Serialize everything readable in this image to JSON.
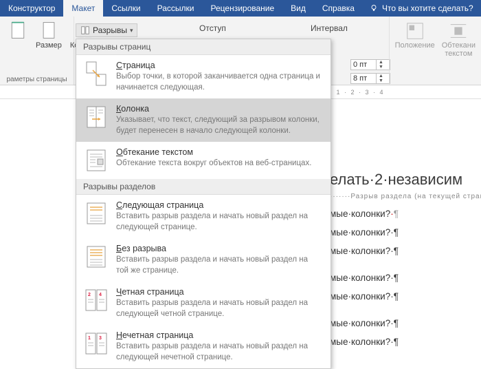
{
  "tabs": {
    "constructor": "Конструктор",
    "layout": "Макет",
    "links": "Ссылки",
    "mailings": "Рассылки",
    "review": "Рецензирование",
    "view": "Вид",
    "help": "Справка",
    "tell_me": "Что вы хотите сделать?"
  },
  "ribbon": {
    "size": "Размер",
    "columns": "Колонки",
    "page_setup": "раметры страницы",
    "breaks_btn": "Разрывы",
    "indent": "Отступ",
    "interval": "Интервал",
    "before_val": "0 пт",
    "after_val": "8 пт",
    "position": "Положение",
    "wrap": "Обтекани",
    "wrap2": "текстом"
  },
  "dropdown": {
    "section1": "Разрывы страниц",
    "items1": [
      {
        "title": "Страница",
        "ul": "С",
        "desc": "Выбор точки, в которой заканчивается одна страница и начинается следующая."
      },
      {
        "title": "Колонка",
        "ul": "К",
        "desc": "Указывает, что текст, следующий за разрывом колонки, будет перенесен в начало следующей колонки."
      },
      {
        "title": "Обтекание текстом",
        "ul": "О",
        "desc": "Обтекание текста вокруг объектов на веб-страницах."
      }
    ],
    "section2": "Разрывы разделов",
    "items2": [
      {
        "title": "Следующая страница",
        "ul": "С",
        "desc": "Вставить разрыв раздела и начать новый раздел на следующей странице."
      },
      {
        "title": "Без разрыва",
        "ul": "Б",
        "desc": "Вставить разрыв раздела и начать новый раздел на той же странице."
      },
      {
        "title": "Четная страница",
        "ul": "Ч",
        "desc": "Вставить разрыв раздела и начать новый раздел на следующей четной странице."
      },
      {
        "title": "Нечетная страница",
        "ul": "Н",
        "desc": "Вставить разрыв раздела и начать новый раздел на следующей нечетной странице."
      }
    ]
  },
  "doc": {
    "heading": "елать·2·независим",
    "section_break": "Разрыв раздела (на текущей странице)",
    "line1": "мые·колонки?",
    "line2": "мые·колонки?·¶",
    "line3": "мые·колонки?·¶",
    "line4": "мые·колонки?·¶",
    "line5": "мые·колонки?·¶",
    "line6": "мые·колонки?·¶",
    "line7": "мые·колонки?·¶"
  },
  "ruler": "· 1 · 2 · 3 · 4"
}
